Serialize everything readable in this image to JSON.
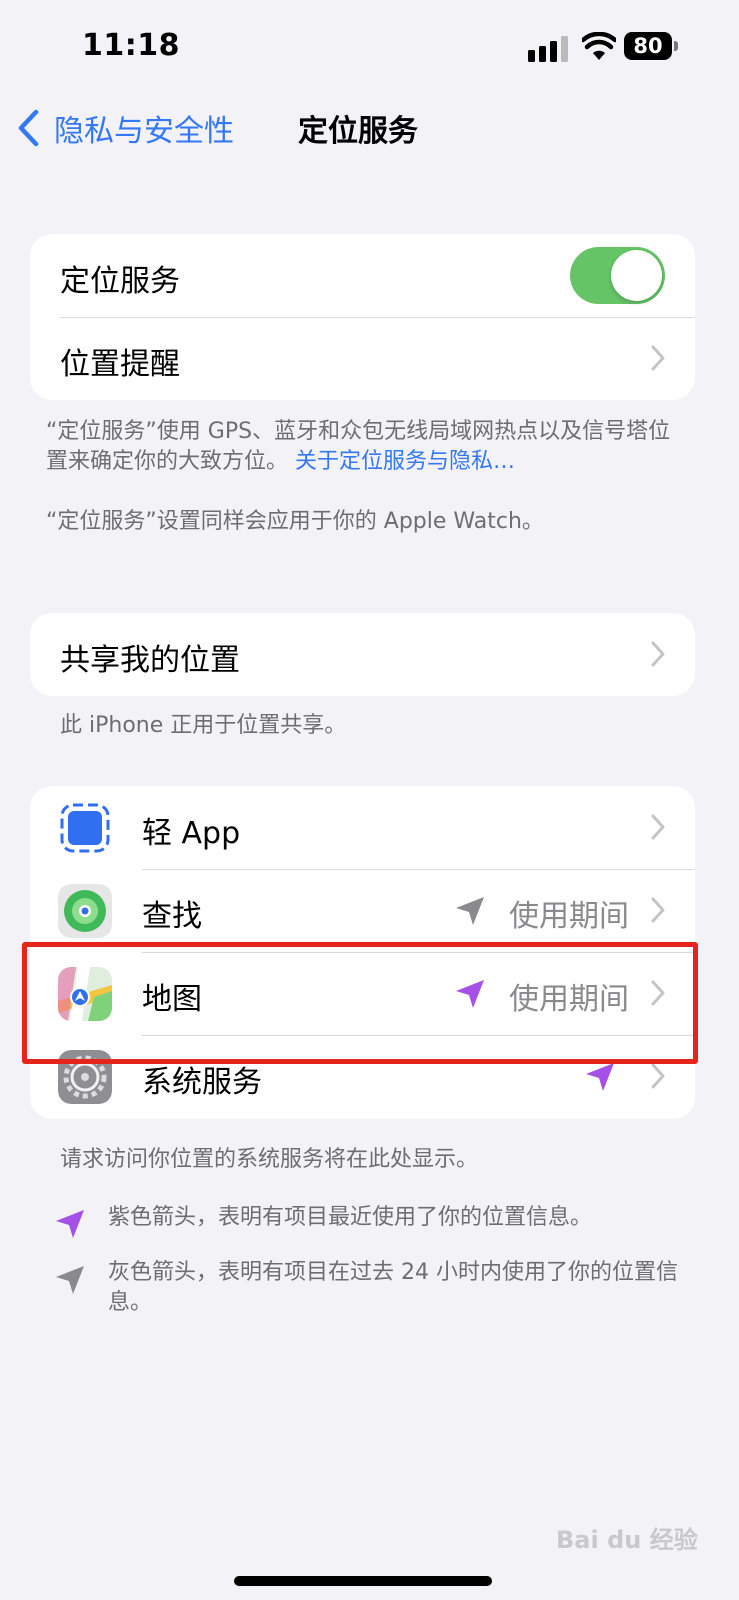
{
  "status_bar": {
    "time": "11:18",
    "battery": "80"
  },
  "nav": {
    "back_label": "隐私与安全性",
    "title": "定位服务"
  },
  "section1": {
    "location_services_label": "定位服务",
    "location_services_on": true,
    "location_alerts_label": "位置提醒"
  },
  "footnote1": {
    "text": "“定位服务”使用 GPS、蓝牙和众包无线局域网热点以及信号塔位置来确定你的大致方位。",
    "link": "关于定位服务与隐私…"
  },
  "footnote2": "“定位服务”设置同样会应用于你的 Apple Watch。",
  "share": {
    "label": "共享我的位置",
    "note": "此 iPhone 正用于位置共享。"
  },
  "apps": [
    {
      "name": "轻 App",
      "value": "",
      "arrow": ""
    },
    {
      "name": "查找",
      "value": "使用期间",
      "arrow": "gray"
    },
    {
      "name": "地图",
      "value": "使用期间",
      "arrow": "purple"
    },
    {
      "name": "系统服务",
      "value": "",
      "arrow": "purple"
    }
  ],
  "system_note": "请求访问你位置的系统服务将在此处显示。",
  "legend": {
    "purple": "紫色箭头，表明有项目最近使用了你的位置信息。",
    "gray": "灰色箭头，表明有项目在过去 24 小时内使用了你的位置信息。"
  },
  "colors": {
    "accent": "#3478f6",
    "toggle_on": "#65c466",
    "arrow_purple": "#a550e6",
    "arrow_gray": "#8a8a8e",
    "highlight": "#e5241c"
  },
  "watermark": "Bai du 经验"
}
